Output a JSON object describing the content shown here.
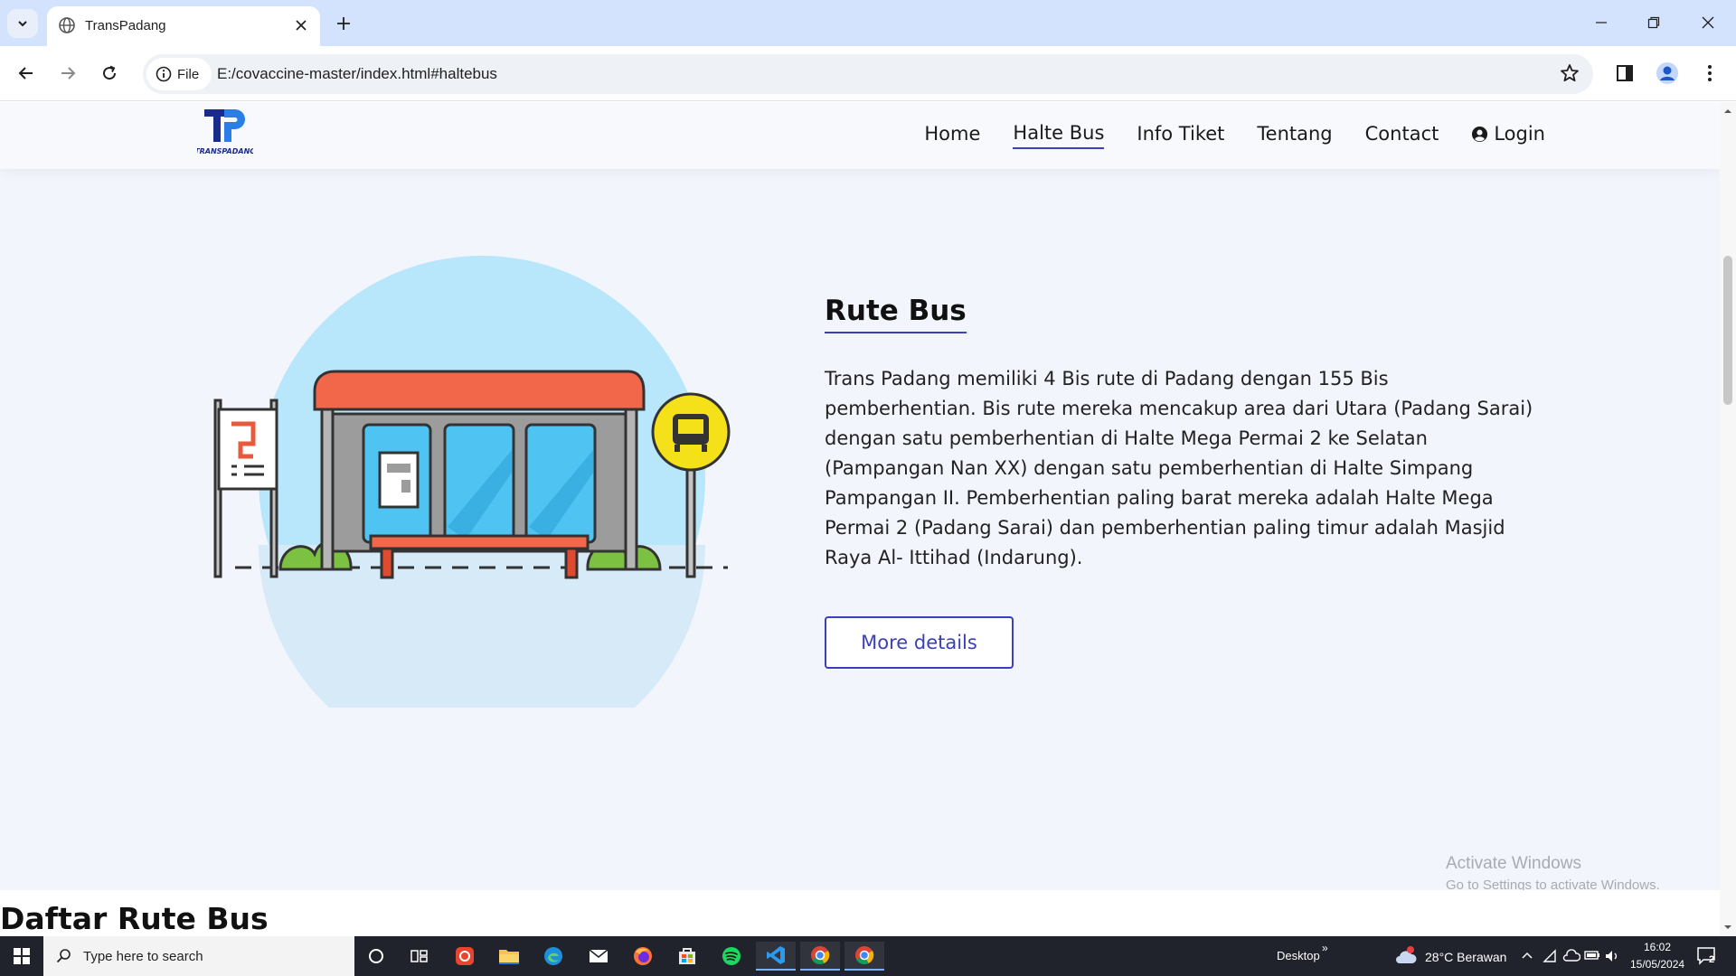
{
  "browser": {
    "tab_title": "TransPadang",
    "file_chip": "File",
    "url": "E:/covaccine-master/index.html#haltebus"
  },
  "site": {
    "logo_text": "TRANSPADANG",
    "nav": [
      {
        "label": "Home"
      },
      {
        "label": "Halte Bus",
        "active": true
      },
      {
        "label": "Info Tiket"
      },
      {
        "label": "Tentang"
      },
      {
        "label": "Contact"
      },
      {
        "label": "Login"
      }
    ]
  },
  "section": {
    "title": "Rute Bus",
    "description": "Trans Padang memiliki 4 Bis rute di Padang dengan 155 Bis pemberhentian. Bis rute mereka mencakup area dari Utara (Padang Sarai) dengan satu pemberhentian di Halte Mega Permai 2 ke Selatan (Pampangan Nan XX) dengan satu pemberhentian di Halte Simpang Pampangan II. Pemberhentian paling barat mereka adalah Halte Mega Permai 2 (Padang Sarai) dan pemberhentian paling timur adalah Masjid Raya Al- Ittihad (Indarung).",
    "button": "More details"
  },
  "list_section": {
    "title": "Daftar Rute Bus"
  },
  "watermark": {
    "line1": "Activate Windows",
    "line2": "Go to Settings to activate Windows."
  },
  "taskbar": {
    "search_placeholder": "Type here to search",
    "desktop_label": "Desktop",
    "weather": "28°C  Berawan",
    "time": "16:02",
    "date": "15/05/2024",
    "notification_count": "2"
  },
  "colors": {
    "accent": "#3b3fb8",
    "tabbar": "#d3e3fd",
    "page_bg": "#f2f5fc",
    "taskbar": "#20232c"
  }
}
